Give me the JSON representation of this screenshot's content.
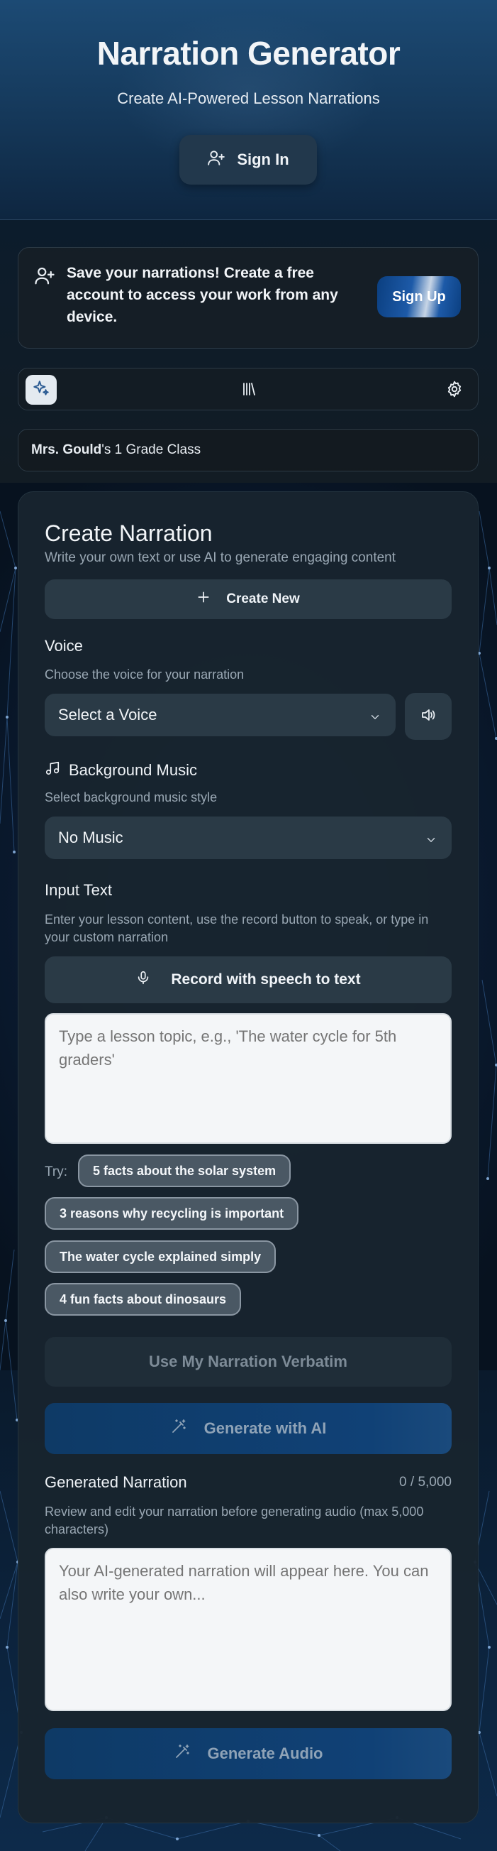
{
  "header": {
    "title": "Narration Generator",
    "subtitle": "Create AI-Powered Lesson Narrations",
    "sign_in_label": "Sign In"
  },
  "banner": {
    "strong": "Save your narrations!",
    "text": " Create a free account to access your work from any device.",
    "sign_up_label": "Sign Up"
  },
  "toolbar": {
    "icons": [
      "sparkle-icon",
      "library-icon",
      "gear-icon"
    ]
  },
  "class_bar": {
    "teacher": "Mrs. Gould",
    "suffix": "'s 1 Grade Class"
  },
  "create": {
    "title": "Create Narration",
    "description": "Write your own text or use AI to generate engaging content",
    "create_new_label": "Create New"
  },
  "voice": {
    "label": "Voice",
    "description": "Choose the voice for your narration",
    "selected": "Select a Voice"
  },
  "music": {
    "label": "Background Music",
    "description": "Select background music style",
    "selected": "No Music"
  },
  "input": {
    "label": "Input Text",
    "description": "Enter your lesson content, use the record button to speak, or type in your custom narration",
    "record_label": "Record with speech to text",
    "placeholder": "Type a lesson topic, e.g., 'The water cycle for 5th graders'"
  },
  "suggestions": {
    "try_label": "Try:",
    "items": [
      "5 facts about the solar system",
      "3 reasons why recycling is important",
      "The water cycle explained simply",
      "4 fun facts about dinosaurs"
    ]
  },
  "actions": {
    "verbatim_label": "Use My Narration Verbatim",
    "generate_ai_label": "Generate with AI"
  },
  "generated": {
    "label": "Generated Narration",
    "count": "0 / 5,000",
    "description": "Review and edit your narration before generating audio (max 5,000 characters)",
    "placeholder": "Your AI-generated narration will appear here. You can also write your own...",
    "generate_audio_label": "Generate Audio"
  },
  "colors": {
    "header_bg": "#1c4a74",
    "card_bg": "#18242e",
    "button_bg": "#2a3a46",
    "primary_blue": "#0e3a66",
    "chip_bg": "#4a5864"
  }
}
